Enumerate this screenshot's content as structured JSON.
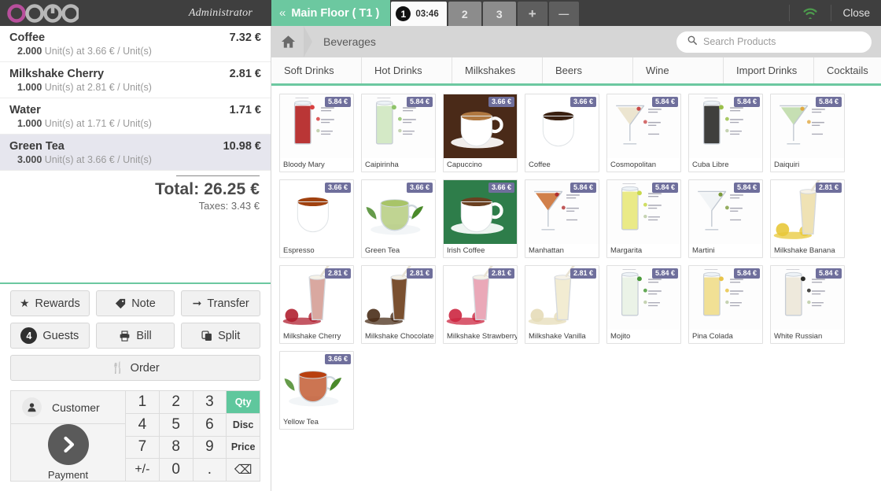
{
  "topbar": {
    "logo_alt": "odoo",
    "user": "Administrator",
    "floor_label": "Main Floor ( T1 )",
    "floor_chevron": "«",
    "order_tabs": [
      {
        "num": "1",
        "clock": "03:46",
        "active": true
      },
      {
        "num": "2",
        "clock": "",
        "active": false
      },
      {
        "num": "3",
        "clock": "",
        "active": false
      }
    ],
    "add_tab": "+",
    "remove_tab": "—",
    "close_label": "Close",
    "wifi_color": "#4d9b4d"
  },
  "order": {
    "lines": [
      {
        "name": "Coffee",
        "qty": "2.000",
        "unit_text": "Unit(s) at 3.66 € / Unit(s)",
        "price": "7.32 €",
        "selected": false
      },
      {
        "name": "Milkshake Cherry",
        "qty": "1.000",
        "unit_text": "Unit(s) at 2.81 € / Unit(s)",
        "price": "2.81 €",
        "selected": false
      },
      {
        "name": "Water",
        "qty": "1.000",
        "unit_text": "Unit(s) at 1.71 € / Unit(s)",
        "price": "1.71 €",
        "selected": false
      },
      {
        "name": "Green Tea",
        "qty": "3.000",
        "unit_text": "Unit(s) at 3.66 € / Unit(s)",
        "price": "10.98 €",
        "selected": true
      }
    ],
    "total_label": "Total: 26.25 €",
    "taxes_label": "Taxes: 3.43 €"
  },
  "actions": {
    "rewards": "Rewards",
    "note": "Note",
    "transfer": "Transfer",
    "guests": "Guests",
    "guests_count": "4",
    "bill": "Bill",
    "split": "Split",
    "order": "Order"
  },
  "pad": {
    "customer_label": "Customer",
    "payment_label": "Payment",
    "keys": [
      "1",
      "2",
      "3",
      "Qty",
      "4",
      "5",
      "6",
      "Disc",
      "7",
      "8",
      "9",
      "Price",
      "+/-",
      "0",
      ".",
      "⌫"
    ],
    "active_mode": "Qty",
    "active_mode_color": "#5fc79d"
  },
  "breadcrumb": {
    "home_icon": "home-icon",
    "category": "Beverages"
  },
  "search": {
    "placeholder": "Search Products",
    "icon": "search-icon"
  },
  "categories": [
    "Soft Drinks",
    "Hot Drinks",
    "Milkshakes",
    "Beers",
    "Wine",
    "Import Drinks",
    "Cocktails"
  ],
  "products": [
    {
      "name": "Bloody Mary",
      "price": "5.84 €",
      "img": "cocktail-red"
    },
    {
      "name": "Caipirinha",
      "price": "5.84 €",
      "img": "cocktail-lime"
    },
    {
      "name": "Capuccino",
      "price": "3.66 €",
      "img": "capuccino"
    },
    {
      "name": "Coffee",
      "price": "3.66 €",
      "img": "coffee"
    },
    {
      "name": "Cosmopolitan",
      "price": "5.84 €",
      "img": "martini-pink"
    },
    {
      "name": "Cuba Libre",
      "price": "5.84 €",
      "img": "cuba-libre"
    },
    {
      "name": "Daiquiri",
      "price": "5.84 €",
      "img": "martini-green"
    },
    {
      "name": "Espresso",
      "price": "3.66 €",
      "img": "espresso"
    },
    {
      "name": "Green Tea",
      "price": "3.66 €",
      "img": "green-tea"
    },
    {
      "name": "Irish Coffee",
      "price": "3.66 €",
      "img": "irish-coffee"
    },
    {
      "name": "Manhattan",
      "price": "5.84 €",
      "img": "martini-amber"
    },
    {
      "name": "Margarita",
      "price": "5.84 €",
      "img": "margarita"
    },
    {
      "name": "Martini",
      "price": "5.84 €",
      "img": "martini-clear"
    },
    {
      "name": "Milkshake Banana",
      "price": "2.81 €",
      "img": "shake-banana"
    },
    {
      "name": "Milkshake Cherry",
      "price": "2.81 €",
      "img": "shake-cherry"
    },
    {
      "name": "Milkshake Chocolate",
      "price": "2.81 €",
      "img": "shake-chocolate"
    },
    {
      "name": "Milkshake Strawberry",
      "price": "2.81 €",
      "img": "shake-strawberry"
    },
    {
      "name": "Milkshake Vanilla",
      "price": "2.81 €",
      "img": "shake-vanilla"
    },
    {
      "name": "Mojito",
      "price": "5.84 €",
      "img": "mojito"
    },
    {
      "name": "Pina Colada",
      "price": "5.84 €",
      "img": "pina-colada"
    },
    {
      "name": "White Russian",
      "price": "5.84 €",
      "img": "white-russian"
    },
    {
      "name": "Yellow Tea",
      "price": "3.66 €",
      "img": "yellow-tea"
    }
  ],
  "colors": {
    "accent_green": "#6cc8a0",
    "price_badge": "#6f6f9c",
    "topbar_dark": "#3f3f3f",
    "selected_line": "#e6e6ee"
  }
}
